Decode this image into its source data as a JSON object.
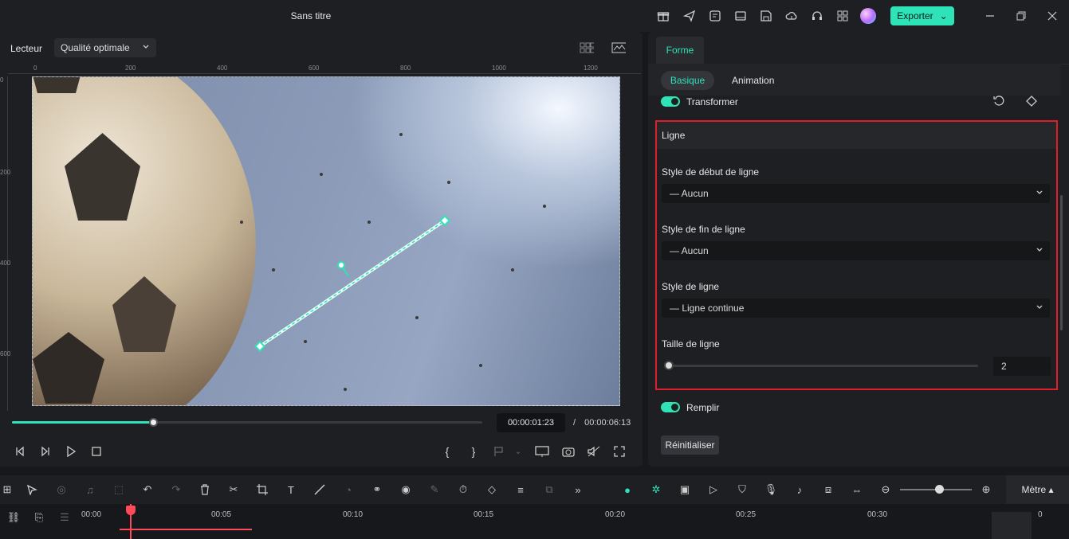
{
  "window": {
    "title": "Sans titre",
    "export_label": "Exporter",
    "icons": [
      "gift-icon",
      "send-icon",
      "tasks-icon",
      "layout-icon",
      "save-icon",
      "cloud-upload-icon",
      "headset-icon",
      "grid-icon"
    ]
  },
  "player": {
    "label": "Lecteur",
    "quality": "Qualité optimale",
    "ruler_top": [
      "0",
      "200",
      "400",
      "600",
      "800",
      "1000",
      "1200"
    ],
    "ruler_left": [
      "0",
      "200",
      "400",
      "600"
    ],
    "progress": 0.3,
    "current_time": "00:00:01:23",
    "separator": "/",
    "total_time": "00:00:06:13"
  },
  "panel": {
    "tab": "Forme",
    "subtabs": {
      "basic": "Basique",
      "animation": "Animation"
    },
    "transform_label": "Transformer",
    "line_section": {
      "title": "Ligne",
      "start_style_label": "Style de début de ligne",
      "start_style_value": "— Aucun",
      "end_style_label": "Style de fin de ligne",
      "end_style_value": "— Aucun",
      "line_style_label": "Style de ligne",
      "line_style_value": "— Ligne continue",
      "size_label": "Taille de ligne",
      "size_value": "2"
    },
    "fill_label": "Remplir",
    "reset_label": "Réinitialiser"
  },
  "toolbar": {
    "unit_label": "Mètre ▴"
  },
  "timeline": {
    "ticks": [
      "00:00",
      "00:05",
      "00:10",
      "00:15",
      "00:20",
      "00:25",
      "00:30"
    ],
    "meter_label": "0"
  },
  "colors": {
    "accent": "#2fe3b9",
    "highlight": "#e01e2b",
    "playhead": "#ff4a5a"
  }
}
